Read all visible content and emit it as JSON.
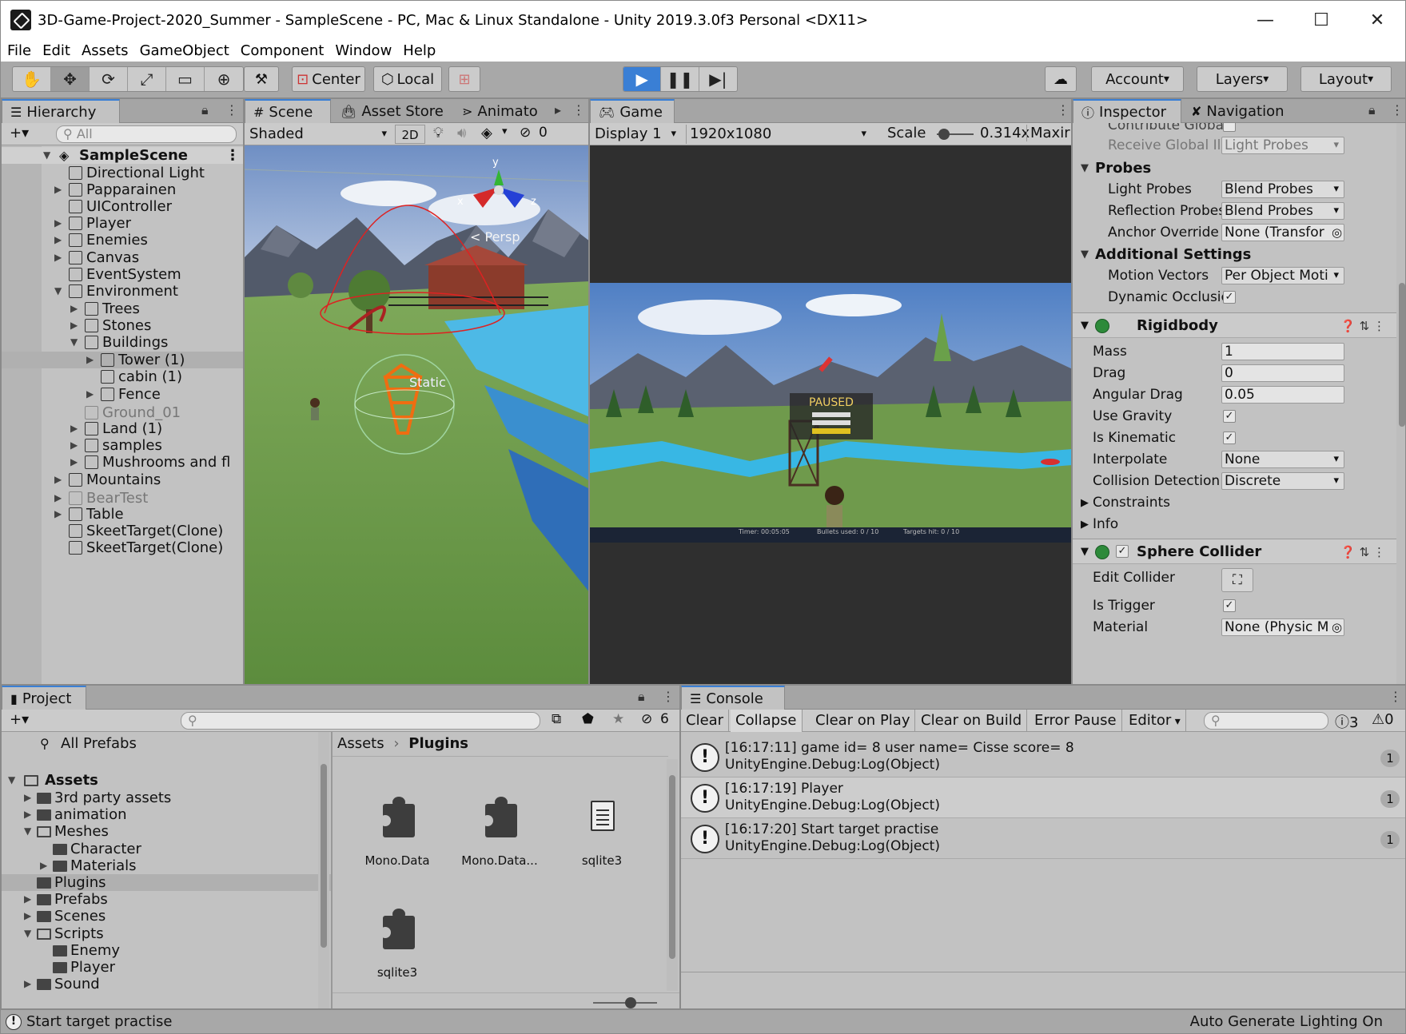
{
  "window": {
    "title": "3D-Game-Project-2020_Summer - SampleScene - PC, Mac & Linux Standalone - Unity 2019.3.0f3 Personal <DX11>"
  },
  "menu": [
    "File",
    "Edit",
    "Assets",
    "GameObject",
    "Component",
    "Window",
    "Help"
  ],
  "toolbar": {
    "center_label": "Center",
    "local_label": "Local",
    "account_label": "Account",
    "layers_label": "Layers",
    "layout_label": "Layout"
  },
  "hierarchy": {
    "tab": "Hierarchy",
    "search_placeholder": "All",
    "scene": "SampleScene",
    "items": [
      {
        "label": "Directional Light"
      },
      {
        "label": "Papparainen"
      },
      {
        "label": "UIController"
      },
      {
        "label": "Player"
      },
      {
        "label": "Enemies"
      },
      {
        "label": "Canvas"
      },
      {
        "label": "EventSystem"
      },
      {
        "label": "Environment"
      },
      {
        "label": "Trees"
      },
      {
        "label": "Stones"
      },
      {
        "label": "Buildings"
      },
      {
        "label": "Tower (1)"
      },
      {
        "label": "cabin (1)"
      },
      {
        "label": "Fence"
      },
      {
        "label": "Ground_01"
      },
      {
        "label": "Land (1)"
      },
      {
        "label": "samples"
      },
      {
        "label": "Mushrooms and fl"
      },
      {
        "label": "Mountains"
      },
      {
        "label": "BearTest"
      },
      {
        "label": "Table"
      },
      {
        "label": "SkeetTarget(Clone)"
      },
      {
        "label": "SkeetTarget(Clone)"
      }
    ]
  },
  "scene_view": {
    "tabs": [
      "Scene",
      "Asset Store",
      "Animato"
    ],
    "shading": "Shaded",
    "mode_2d": "2D",
    "hidden_count": "0",
    "persp_label": "< Persp",
    "static_label": "Static",
    "gizmo_x": "x",
    "gizmo_y": "y",
    "gizmo_z": "z"
  },
  "game_view": {
    "tab": "Game",
    "display": "Display 1",
    "resolution": "1920x1080",
    "scale_label": "Scale",
    "scale_value": "0.314x",
    "maximize": "Maxir",
    "paused_text": "PAUSED",
    "hud_timer": "Timer:  00:05:05",
    "hud_bullets": "Bullets used:  0 / 10",
    "hud_targets": "Targets hit:  0 / 10"
  },
  "inspector": {
    "tabs": [
      "Inspector",
      "Navigation"
    ],
    "cut_row": "Contribute Globa",
    "receive_gi": {
      "label": "Receive Global Ill",
      "value": "Light Probes"
    },
    "probes_header": "Probes",
    "light_probes": {
      "label": "Light Probes",
      "value": "Blend Probes"
    },
    "reflection_probes": {
      "label": "Reflection Probes",
      "value": "Blend Probes"
    },
    "anchor_override": {
      "label": "Anchor Override",
      "value": "None (Transfor"
    },
    "additional_header": "Additional Settings",
    "motion_vectors": {
      "label": "Motion Vectors",
      "value": "Per Object Moti"
    },
    "dynamic_occlusion": {
      "label": "Dynamic Occlusic"
    },
    "rigidbody": {
      "title": "Rigidbody",
      "mass": {
        "label": "Mass",
        "value": "1"
      },
      "drag": {
        "label": "Drag",
        "value": "0"
      },
      "angular_drag": {
        "label": "Angular Drag",
        "value": "0.05"
      },
      "use_gravity": {
        "label": "Use Gravity"
      },
      "is_kinematic": {
        "label": "Is Kinematic"
      },
      "interpolate": {
        "label": "Interpolate",
        "value": "None"
      },
      "collision": {
        "label": "Collision Detection",
        "value": "Discrete"
      },
      "constraints": "Constraints",
      "info": "Info"
    },
    "sphere_collider": {
      "title": "Sphere Collider",
      "edit_collider": "Edit Collider",
      "is_trigger": "Is Trigger",
      "material": {
        "label": "Material",
        "value": "None (Physic M"
      }
    }
  },
  "project": {
    "tab": "Project",
    "hidden_count": "6",
    "favorites": "All Prefabs",
    "root": "Assets",
    "tree": [
      {
        "label": "3rd party assets"
      },
      {
        "label": "animation"
      },
      {
        "label": "Meshes"
      },
      {
        "label": "Character"
      },
      {
        "label": "Materials"
      },
      {
        "label": "Plugins"
      },
      {
        "label": "Prefabs"
      },
      {
        "label": "Scenes"
      },
      {
        "label": "Scripts"
      },
      {
        "label": "Enemy"
      },
      {
        "label": "Player"
      },
      {
        "label": "Sound"
      }
    ],
    "breadcrumb_root": "Assets",
    "breadcrumb_current": "Plugins",
    "assets": [
      {
        "name": "Mono.Data",
        "icon": "plugin-icon"
      },
      {
        "name": "Mono.Data...",
        "icon": "plugin-icon"
      },
      {
        "name": "sqlite3",
        "icon": "text-file-icon"
      },
      {
        "name": "sqlite3",
        "icon": "plugin-icon"
      }
    ]
  },
  "console": {
    "tab": "Console",
    "buttons": [
      "Clear",
      "Collapse",
      "Clear on Play",
      "Clear on Build",
      "Error Pause",
      "Editor"
    ],
    "warn_count": "3",
    "error_count": "0",
    "entries": [
      {
        "line1": "[16:17:11] game id= 8 user name= Cisse score= 8",
        "line2": "UnityEngine.Debug:Log(Object)",
        "count": "1"
      },
      {
        "line1": "[16:17:19] Player",
        "line2": "UnityEngine.Debug:Log(Object)",
        "count": "1"
      },
      {
        "line1": "[16:17:20] Start target practise",
        "line2": "UnityEngine.Debug:Log(Object)",
        "count": "1"
      }
    ]
  },
  "status": {
    "message": "Start target practise",
    "right": "Auto Generate Lighting On"
  }
}
